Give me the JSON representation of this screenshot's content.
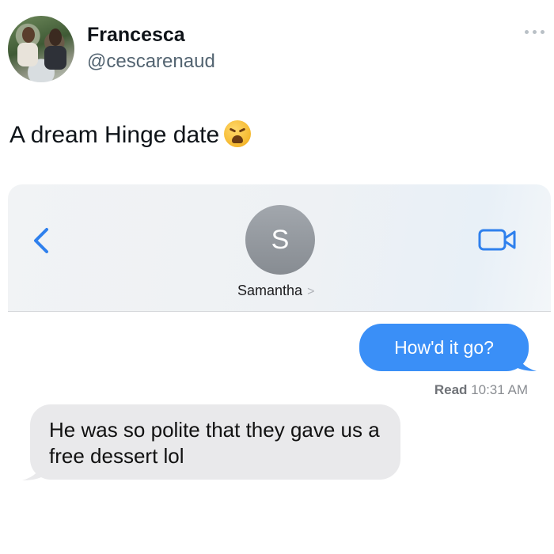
{
  "tweet": {
    "display_name": "Francesca",
    "handle": "@cescarenaud",
    "text": "A dream Hinge date",
    "emoji": "weary-face"
  },
  "conversation": {
    "contact_initial": "S",
    "contact_name": "Samantha",
    "contact_chevron": ">",
    "outgoing_message": "How'd it go?",
    "read_label": "Read",
    "read_time": "10:31 AM",
    "incoming_message": "He was so polite that they gave us a free dessert lol"
  },
  "colors": {
    "outgoing_bubble": "#3a8ff7",
    "incoming_bubble": "#e9e9eb",
    "ios_blue": "#2f80ed",
    "handle_gray": "#536471"
  }
}
